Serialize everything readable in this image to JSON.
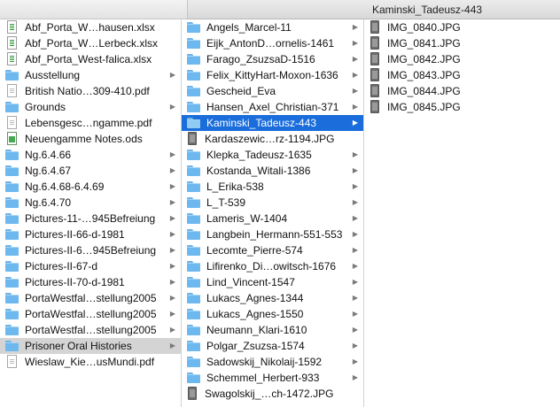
{
  "window": {
    "title": "Kaminski_Tadeusz-443"
  },
  "columns": {
    "col1": [
      {
        "label": "Abf_Porta_W…hausen.xlsx",
        "type": "sheet",
        "has_children": false
      },
      {
        "label": "Abf_Porta_W…Lerbeck.xlsx",
        "type": "sheet",
        "has_children": false
      },
      {
        "label": "Abf_Porta_West-falica.xlsx",
        "type": "sheet",
        "has_children": false
      },
      {
        "label": "Ausstellung",
        "type": "folder",
        "has_children": true
      },
      {
        "label": "British Natio…309-410.pdf",
        "type": "doc",
        "has_children": false
      },
      {
        "label": "Grounds",
        "type": "folder",
        "has_children": true
      },
      {
        "label": "Lebensgesc…ngamme.pdf",
        "type": "doc",
        "has_children": false
      },
      {
        "label": "Neuengamme Notes.ods",
        "type": "ods",
        "has_children": false
      },
      {
        "label": "Ng.6.4.66",
        "type": "folder",
        "has_children": true
      },
      {
        "label": "Ng.6.4.67",
        "type": "folder",
        "has_children": true
      },
      {
        "label": "Ng.6.4.68-6.4.69",
        "type": "folder",
        "has_children": true
      },
      {
        "label": "Ng.6.4.70",
        "type": "folder",
        "has_children": true
      },
      {
        "label": "Pictures-11-…945Befreiung",
        "type": "folder",
        "has_children": true
      },
      {
        "label": "Pictures-II-66-d-1981",
        "type": "folder",
        "has_children": true
      },
      {
        "label": "Pictures-II-6…945Befreiung",
        "type": "folder",
        "has_children": true
      },
      {
        "label": "Pictures-II-67-d",
        "type": "folder",
        "has_children": true
      },
      {
        "label": "Pictures-II-70-d-1981",
        "type": "folder",
        "has_children": true
      },
      {
        "label": "PortaWestfal…stellung2005",
        "type": "folder",
        "has_children": true
      },
      {
        "label": "PortaWestfal…stellung2005",
        "type": "folder",
        "has_children": true
      },
      {
        "label": "PortaWestfal…stellung2005",
        "type": "folder",
        "has_children": true
      },
      {
        "label": "Prisoner Oral Histories",
        "type": "folder",
        "has_children": true,
        "selected": "grey"
      },
      {
        "label": "Wieslaw_Kie…usMundi.pdf",
        "type": "doc",
        "has_children": false
      }
    ],
    "col2": [
      {
        "label": "Angels_Marcel-11",
        "type": "folder",
        "has_children": true
      },
      {
        "label": "Eijk_AntonD…ornelis-1461",
        "type": "folder",
        "has_children": true
      },
      {
        "label": "Farago_ZsuzsaD-1516",
        "type": "folder",
        "has_children": true
      },
      {
        "label": "Felix_KittyHart-Moxon-1636",
        "type": "folder",
        "has_children": true
      },
      {
        "label": "Gescheid_Eva",
        "type": "folder",
        "has_children": true
      },
      {
        "label": "Hansen_Axel_Christian-371",
        "type": "folder",
        "has_children": true
      },
      {
        "label": "Kaminski_Tadeusz-443",
        "type": "folder",
        "has_children": true,
        "selected": "blue"
      },
      {
        "label": "Kardaszewic…rz-1194.JPG",
        "type": "img",
        "has_children": false
      },
      {
        "label": "Klepka_Tadeusz-1635",
        "type": "folder",
        "has_children": true
      },
      {
        "label": "Kostanda_Witali-1386",
        "type": "folder",
        "has_children": true
      },
      {
        "label": "L_Erika-538",
        "type": "folder",
        "has_children": true
      },
      {
        "label": "L_T-539",
        "type": "folder",
        "has_children": true
      },
      {
        "label": "Lameris_W-1404",
        "type": "folder",
        "has_children": true
      },
      {
        "label": "Langbein_Hermann-551-553",
        "type": "folder",
        "has_children": true
      },
      {
        "label": "Lecomte_Pierre-574",
        "type": "folder",
        "has_children": true
      },
      {
        "label": "Lifirenko_Di…owitsch-1676",
        "type": "folder",
        "has_children": true
      },
      {
        "label": "Lind_Vincent-1547",
        "type": "folder",
        "has_children": true
      },
      {
        "label": "Lukacs_Agnes-1344",
        "type": "folder",
        "has_children": true
      },
      {
        "label": "Lukacs_Agnes-1550",
        "type": "folder",
        "has_children": true
      },
      {
        "label": "Neumann_Klari-1610",
        "type": "folder",
        "has_children": true
      },
      {
        "label": "Polgar_Zsuzsa-1574",
        "type": "folder",
        "has_children": true
      },
      {
        "label": "Sadowskij_Nikolaij-1592",
        "type": "folder",
        "has_children": true
      },
      {
        "label": "Schemmel_Herbert-933",
        "type": "folder",
        "has_children": true
      },
      {
        "label": "Swagolskij_…ch-1472.JPG",
        "type": "img",
        "has_children": false
      }
    ],
    "col3": [
      {
        "label": "IMG_0840.JPG",
        "type": "img",
        "has_children": false
      },
      {
        "label": "IMG_0841.JPG",
        "type": "img",
        "has_children": false
      },
      {
        "label": "IMG_0842.JPG",
        "type": "img",
        "has_children": false
      },
      {
        "label": "IMG_0843.JPG",
        "type": "img",
        "has_children": false
      },
      {
        "label": "IMG_0844.JPG",
        "type": "img",
        "has_children": false
      },
      {
        "label": "IMG_0845.JPG",
        "type": "img",
        "has_children": false
      }
    ]
  }
}
